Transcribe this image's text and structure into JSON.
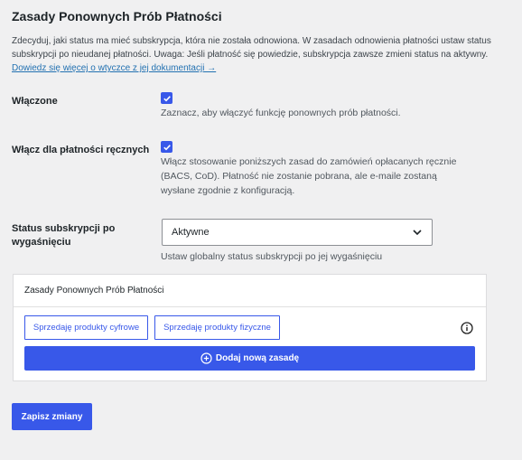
{
  "page": {
    "title": "Zasady Ponownych Prób Płatności",
    "intro": "Zdecyduj, jaki status ma mieć subskrypcja, która nie została odnowiona. W zasadach odnowienia płatności ustaw status subskrypcji po nieudanej płatności. Uwaga: Jeśli płatność się powiedzie, subskrypcja zawsze zmieni status na aktywny.",
    "doc_link": "Dowiedz się więcej o wtyczce z jej dokumentacji →"
  },
  "enabled": {
    "label": "Włączone",
    "checked": true,
    "description": "Zaznacz, aby włączyć funkcję ponownych prób płatności."
  },
  "manual": {
    "label": "Włącz dla płatności ręcznych",
    "checked": true,
    "description": "Włącz stosowanie poniższych zasad do zamówień opłacanych ręcznie (BACS, CoD). Płatność nie zostanie pobrana, ale e-maile zostaną wysłane zgodnie z konfiguracją."
  },
  "status": {
    "label": "Status subskrypcji po wygaśnięciu",
    "selected": "Aktywne",
    "help": "Ustaw globalny status subskrypcji po jej wygaśnięciu"
  },
  "rules_panel": {
    "title": "Zasady Ponownych Prób Płatności",
    "digital_button": "Sprzedaję produkty cyfrowe",
    "physical_button": "Sprzedaję produkty fizyczne",
    "add_rule_button": "Dodaj nową zasadę"
  },
  "save_button": "Zapisz zmiany",
  "colors": {
    "accent": "#3858e9",
    "link": "#2271b1",
    "background": "#f0f0f1"
  }
}
